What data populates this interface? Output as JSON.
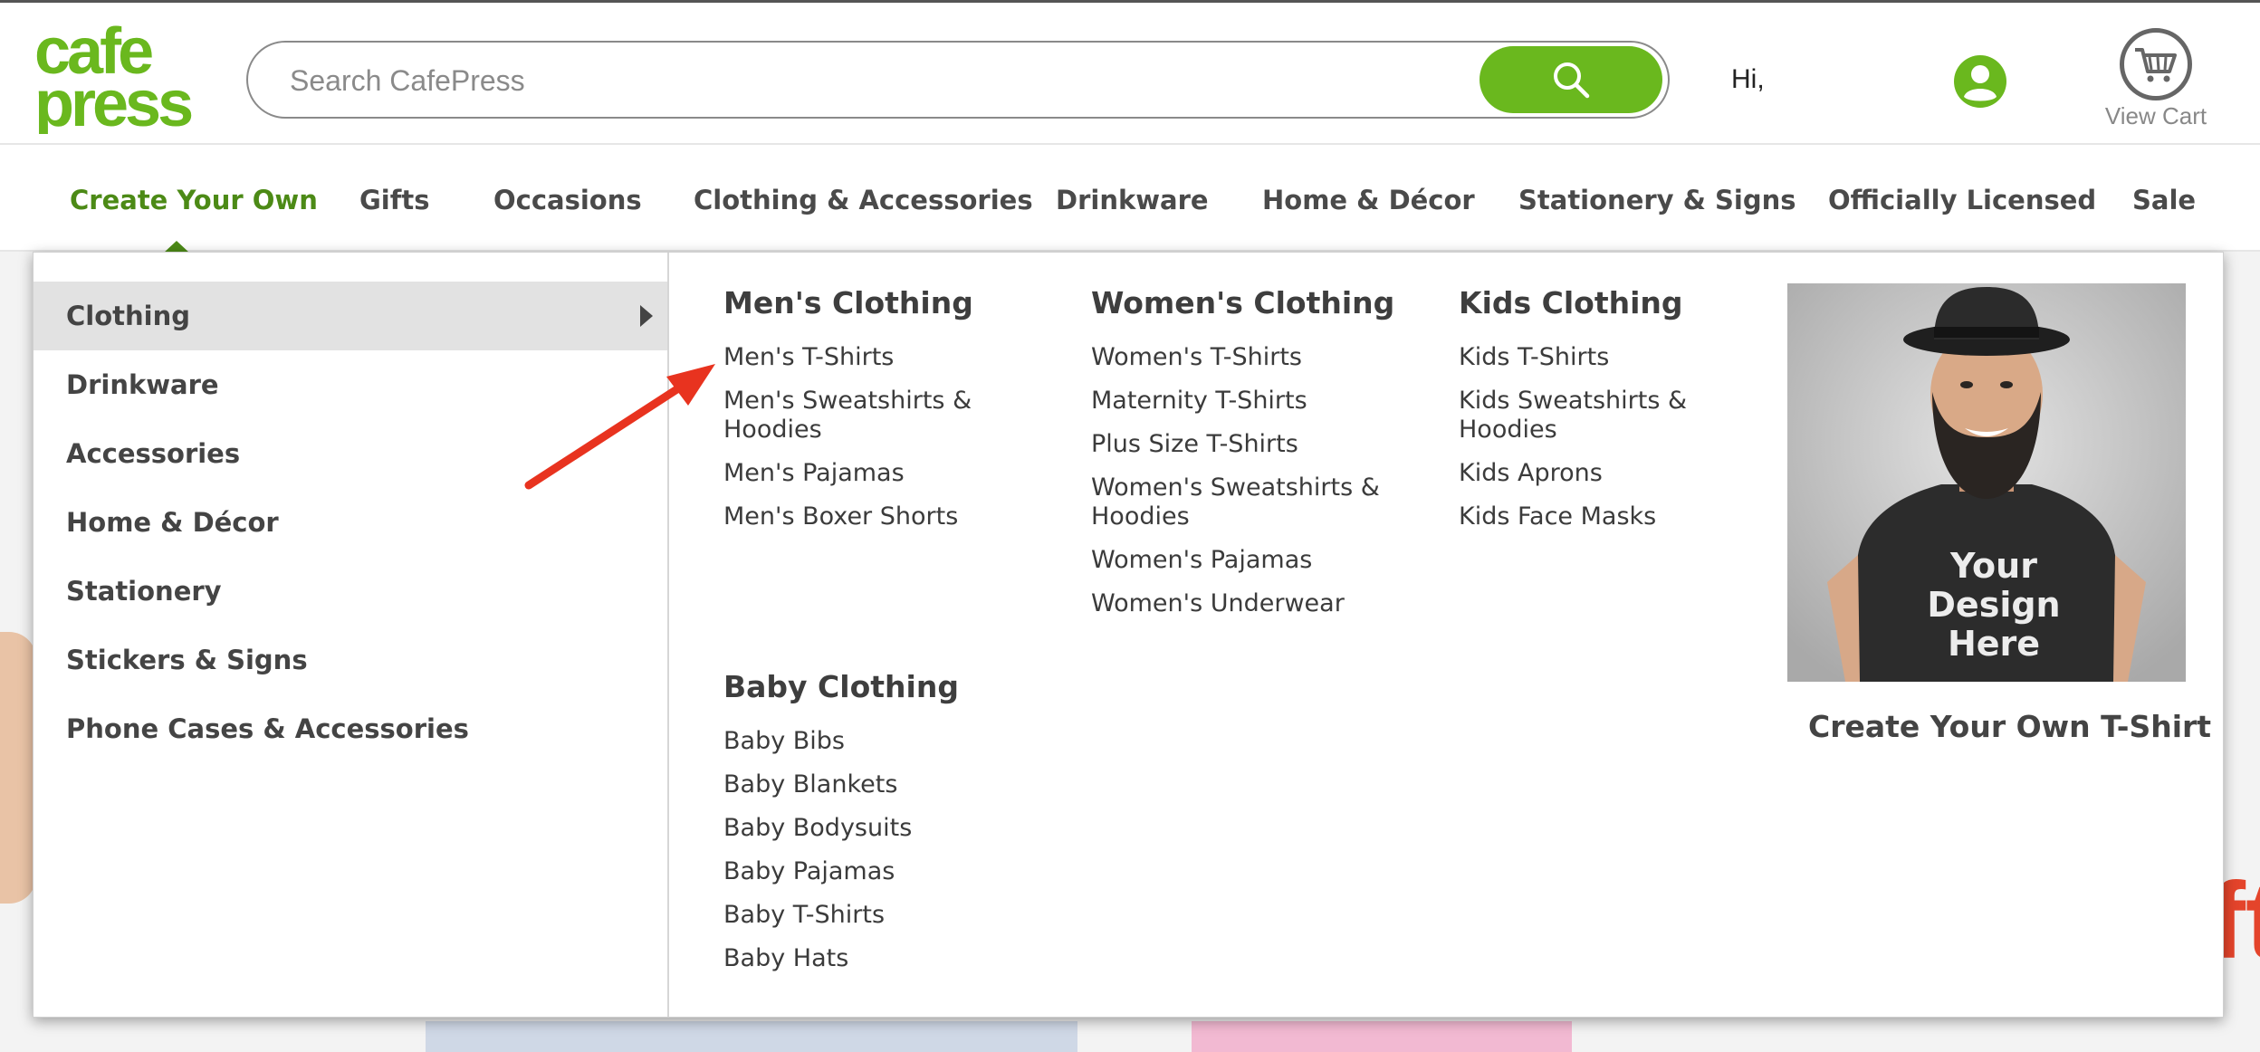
{
  "header": {
    "logo_line1": "cafe",
    "logo_line2": "press",
    "search_placeholder": "Search CafePress",
    "greeting": "Hi,",
    "cart_label": "View Cart"
  },
  "colors": {
    "brand_green": "#6ab81e",
    "nav_active": "#4c8a16",
    "annotation_red": "#e8331f"
  },
  "nav": {
    "items": [
      {
        "label": "Create Your Own"
      },
      {
        "label": "Gifts"
      },
      {
        "label": "Occasions"
      },
      {
        "label": "Clothing & Accessories"
      },
      {
        "label": "Drinkware"
      },
      {
        "label": "Home & Décor"
      },
      {
        "label": "Stationery & Signs"
      },
      {
        "label": "Officially Licensed"
      },
      {
        "label": "Sale"
      }
    ]
  },
  "menu": {
    "categories": [
      {
        "label": "Clothing"
      },
      {
        "label": "Drinkware"
      },
      {
        "label": "Accessories"
      },
      {
        "label": "Home & Décor"
      },
      {
        "label": "Stationery"
      },
      {
        "label": "Stickers & Signs"
      },
      {
        "label": "Phone Cases & Accessories"
      }
    ],
    "groups": {
      "mens": {
        "title": "Men's Clothing",
        "links": [
          "Men's T-Shirts",
          "Men's Sweatshirts & Hoodies",
          "Men's Pajamas",
          "Men's Boxer Shorts"
        ]
      },
      "womens": {
        "title": "Women's Clothing",
        "links": [
          "Women's T-Shirts",
          "Maternity T-Shirts",
          "Plus Size T-Shirts",
          "Women's Sweatshirts & Hoodies",
          "Women's Pajamas",
          "Women's Underwear"
        ]
      },
      "kids": {
        "title": "Kids Clothing",
        "links": [
          "Kids T-Shirts",
          "Kids Sweatshirts & Hoodies",
          "Kids Aprons",
          "Kids Face Masks"
        ]
      },
      "baby": {
        "title": "Baby Clothing",
        "links": [
          "Baby Bibs",
          "Baby Blankets",
          "Baby Bodysuits",
          "Baby Pajamas",
          "Baby T-Shirts",
          "Baby Hats"
        ]
      }
    },
    "promo": {
      "shirt_text": "Your Design Here",
      "caption": "Create Your Own T-Shirt"
    }
  }
}
